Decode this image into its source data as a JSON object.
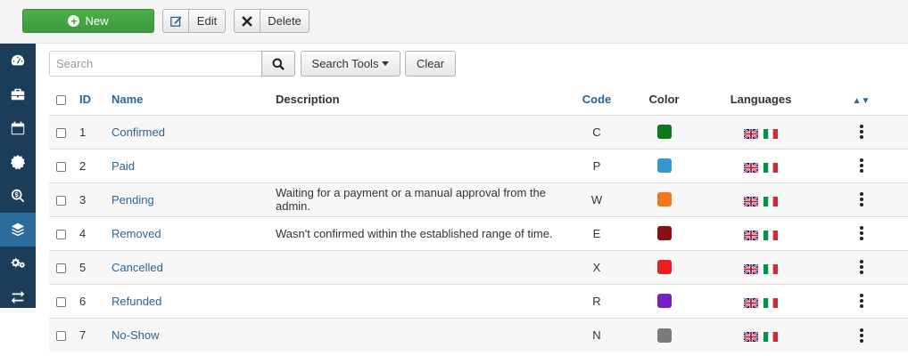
{
  "toolbar": {
    "new_label": "New",
    "edit_label": "Edit",
    "delete_label": "Delete"
  },
  "sidebar": {
    "items": [
      {
        "icon": "dashboard-icon",
        "active": false
      },
      {
        "icon": "briefcase-icon",
        "active": false
      },
      {
        "icon": "calendar-icon",
        "active": false
      },
      {
        "icon": "badge-icon",
        "active": false
      },
      {
        "icon": "money-search-icon",
        "active": false
      },
      {
        "icon": "layers-icon",
        "active": true
      },
      {
        "icon": "gears-icon",
        "active": false
      },
      {
        "icon": "exchange-icon",
        "active": false
      }
    ]
  },
  "search": {
    "placeholder": "Search",
    "value": "",
    "tools_label": "Search Tools",
    "clear_label": "Clear"
  },
  "table": {
    "headers": {
      "id": "ID",
      "name": "Name",
      "description": "Description",
      "code": "Code",
      "color": "Color",
      "languages": "Languages"
    },
    "rows": [
      {
        "id": "1",
        "name": "Confirmed",
        "description": "",
        "code": "C",
        "color": "#0b7a1e"
      },
      {
        "id": "2",
        "name": "Paid",
        "description": "",
        "code": "P",
        "color": "#3596d4"
      },
      {
        "id": "3",
        "name": "Pending",
        "description": "Waiting for a payment or a manual approval from the admin.",
        "code": "W",
        "color": "#f5741f"
      },
      {
        "id": "4",
        "name": "Removed",
        "description": "Wasn't confirmed within the established range of time.",
        "code": "E",
        "color": "#8b0e14"
      },
      {
        "id": "5",
        "name": "Cancelled",
        "description": "",
        "code": "X",
        "color": "#ee1c25"
      },
      {
        "id": "6",
        "name": "Refunded",
        "description": "",
        "code": "R",
        "color": "#7a1fbf"
      },
      {
        "id": "7",
        "name": "No-Show",
        "description": "",
        "code": "N",
        "color": "#7a7a7a"
      }
    ]
  }
}
